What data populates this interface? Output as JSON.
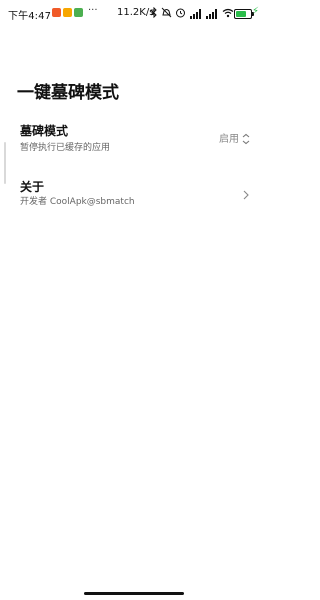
{
  "status_bar": {
    "time": "下午4:47",
    "more": "···",
    "net_speed": "11.2K/s",
    "battery_level": 0.7,
    "colors": {
      "app1": "#f05a28",
      "app2": "#f7a600",
      "app3": "#4caf50",
      "battery_fill": "#2bbd4b"
    }
  },
  "page": {
    "title": "一键墓碑模式"
  },
  "items": [
    {
      "title": "墓碑模式",
      "subtitle": "暂停执行已缓存的应用",
      "value": "启用"
    },
    {
      "title": "关于",
      "subtitle": "开发者 CoolApk@sbmatch"
    }
  ]
}
